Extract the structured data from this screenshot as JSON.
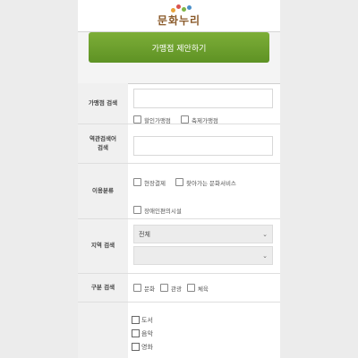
{
  "header": {
    "logo_text": "문화누리"
  },
  "propose_button": "가맹점 제안하기",
  "rows": {
    "store_search": {
      "label": "가맹점 검색",
      "options": [
        "할인가맹점",
        "축제가맹점"
      ]
    },
    "station_search": {
      "label_line1": "역관검색어",
      "label_line2": "검색"
    },
    "usage_type": {
      "label": "이용분류",
      "options": [
        "현장결제",
        "찾아가는 문화서비스",
        "장애인편의시설"
      ]
    },
    "region_search": {
      "label": "지역 검색",
      "select1": "전체",
      "select2": ""
    },
    "category_search": {
      "label": "구분 검색",
      "options": [
        "문화",
        "관광",
        "체육"
      ]
    },
    "subcategory": {
      "options": [
        "도서",
        "음악",
        "영화"
      ]
    }
  },
  "colors": {
    "accent": "#6a9e2d",
    "logo_brown": "#8a5a2a"
  }
}
